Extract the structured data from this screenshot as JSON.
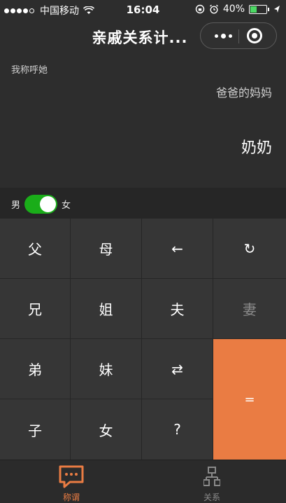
{
  "status_bar": {
    "carrier": "中国移动",
    "time": "16:04",
    "battery_percent": "40%",
    "battery_level": 0.4,
    "icons": [
      "signal-dots",
      "wifi-icon",
      "lock-rotation-icon",
      "alarm-icon",
      "location-icon",
      "battery-icon"
    ]
  },
  "nav": {
    "title": "亲戚关系计...",
    "more_icon": "more-dots-icon",
    "close_icon": "close-circle-icon"
  },
  "display": {
    "call_label": "我称呼她",
    "relation_input": "爸爸的妈妈",
    "result": "奶奶"
  },
  "gender": {
    "male_label": "男",
    "female_label": "女",
    "selected": "女"
  },
  "keypad": {
    "father": "父",
    "mother": "母",
    "backspace": "←",
    "reset": "↻",
    "elder_brother": "兄",
    "elder_sister": "姐",
    "husband": "夫",
    "wife": "妻",
    "younger_brother": "弟",
    "younger_sister": "妹",
    "swap": "⇄",
    "equals": "=",
    "son": "子",
    "daughter": "女",
    "question": "?"
  },
  "tabs": {
    "calc_label": "称谓",
    "relation_label": "关系"
  },
  "colors": {
    "accent": "#ea7c43",
    "toggle_on": "#1aad19",
    "background": "#2d2d2d",
    "key": "#363636"
  }
}
